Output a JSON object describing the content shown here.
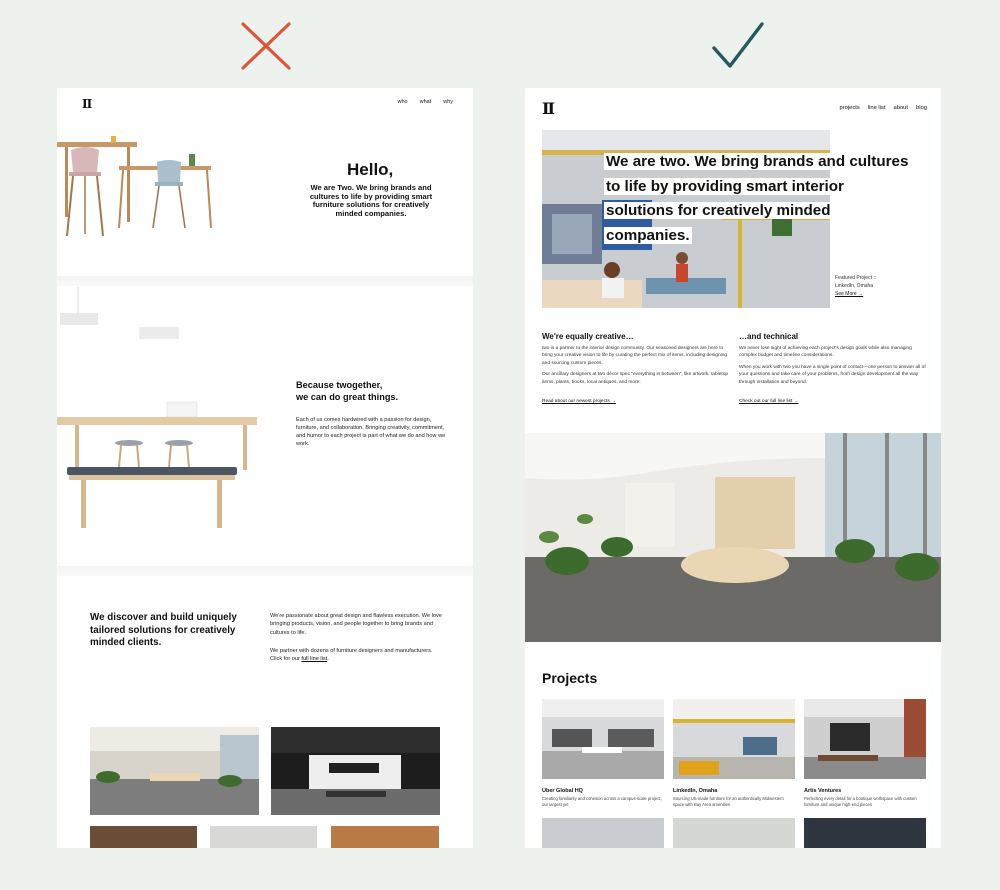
{
  "marks": {
    "bad": "cross-icon",
    "good": "check-icon",
    "bad_color": "#d9583b",
    "good_color": "#24595e"
  },
  "left": {
    "logo": "II",
    "nav": [
      "who",
      "what",
      "why"
    ],
    "hero": {
      "title": "Hello,",
      "copy": "We are Two. We bring brands and cultures to life by providing smart furniture solutions for creatively minded companies."
    },
    "together": {
      "heading_line1": "Because twogether,",
      "heading_line2": "we can do great things.",
      "body": "Each of us comes hardwired with a passion for design, furniture, and collaboration. Bringing creativity, commitment, and humor to each project is part of what we do and how we work."
    },
    "discover": {
      "heading": "We discover and build uniquely tailored solutions for creatively minded clients.",
      "p1": "We're passionate about great design and flawless execution. We love bringing products, vision, and people together to bring brands and cultures to life.",
      "p2_text": "We partner with dozens of furniture designers and manufacturers. Click for our",
      "p2_link": "full line list",
      "p2_end": "."
    }
  },
  "right": {
    "logo": "II",
    "nav": [
      "projects",
      "line list",
      "about",
      "blog"
    ],
    "hero_lines": [
      "We are two. We bring brands and cultures",
      "to life by providing smart interior",
      "solutions for creatively minded",
      "companies."
    ],
    "featured": {
      "label": "Featured Project ::",
      "project": "LinkedIn, Omaha",
      "link": "See More →"
    },
    "creative": {
      "heading": "We're equally creative…",
      "p1": "two is a partner to the interior design community. Our seasoned designers are here to bring your creative vision to life by curating the perfect mix of items, including designing and sourcing custom pieces.",
      "p2": "Our ancillary designers at two décor spec \"everything in between\", like artwork, tabletop items, plants, books, local antiques, and more.",
      "link": "Read about our newest projects →"
    },
    "technical": {
      "heading": "…and technical",
      "p1": "We never lose sight of achieving each project's design goals while also managing complex budget and timeline considerations.",
      "p2": "When you work with two you have a single point of contact—one person to answer all of your questions and take care of your problems, from design development all the way through installation and beyond.",
      "link": "Check out our full line list →"
    },
    "projects_title": "Projects",
    "projects": [
      {
        "name": "Uber Global HQ",
        "desc": "Creating familiarity and cohesion across a campus-scale project, our largest yet"
      },
      {
        "name": "LinkedIn, Omaha",
        "desc": "Sourcing US-made furniture for an authentically Midwestern space with Bay Area amenities"
      },
      {
        "name": "Artis Ventures",
        "desc": "Perfecting every detail for a boutique workspace with custom furniture and unique high-end pieces"
      }
    ]
  }
}
